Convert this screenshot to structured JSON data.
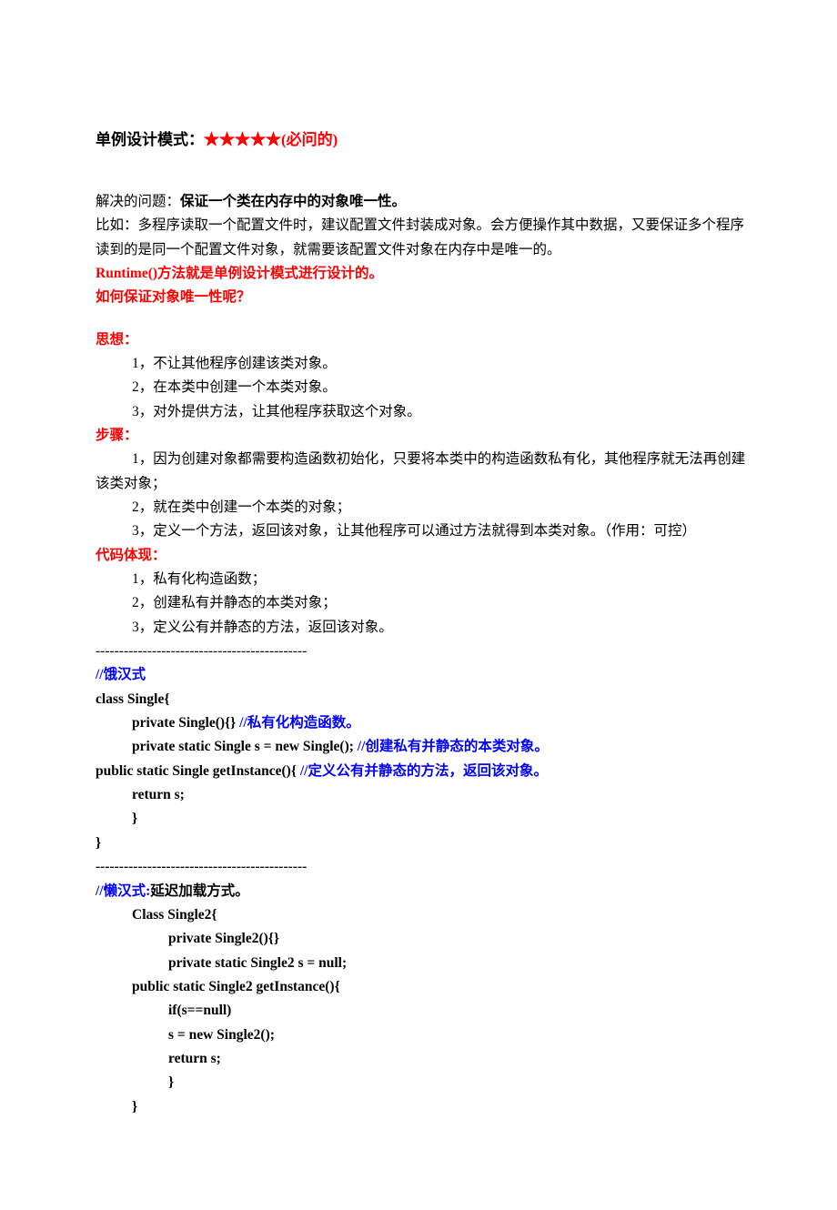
{
  "title_prefix": "单例设计模式：",
  "title_stars": "★★★★★",
  "title_suffix": "(必问的)",
  "intro1a": "解决的问题：",
  "intro1b": "保证一个类在内存中的对象唯一性。",
  "intro2": "比如：多程序读取一个配置文件时，建议配置文件封装成对象。会方便操作其中数据，又要保证多个程序读到的是同一个配置文件对象，就需要该配置文件对象在内存中是唯一的。",
  "intro3": "Runtime()方法就是单例设计模式进行设计的。",
  "intro4": "如何保证对象唯一性呢？",
  "h_think": "思想：",
  "think1": "1，不让其他程序创建该类对象。",
  "think2": "2，在本类中创建一个本类对象。",
  "think3": "3，对外提供方法，让其他程序获取这个对象。",
  "h_steps": "步骤：",
  "step1": "1，因为创建对象都需要构造函数初始化，只要将本类中的构造函数私有化，其他程序就无法再创建该类对象；",
  "step2": "2，就在类中创建一个本类的对象；",
  "step3": "3，定义一个方法，返回该对象，让其他程序可以通过方法就得到本类对象。（作用：可控）",
  "h_code": "代码体现：",
  "code1": "1，私有化构造函数；",
  "code2": "2，创建私有并静态的本类对象；",
  "code3": "3，定义公有并静态的方法，返回该对象。",
  "sep": "---------------------------------------------",
  "eager_label": "//饿汉式",
  "eager_l1": "class Single{",
  "eager_l2a": "private Single(){}          ",
  "eager_l2b": "//私有化构造函数。",
  "eager_l3a": "private static Single s = new Single(); ",
  "eager_l3b": "//创建私有并静态的本类对象。",
  "eager_l4a": "public static Single getInstance(){     ",
  "eager_l4b": "//定义公有并静态的方法，返回该对象。",
  "eager_l5": "return s;",
  "eager_l6": "}",
  "eager_l7": "}",
  "lazy_label": "//懒汉式:",
  "lazy_label2": "延迟加载方式。",
  "lazy_l1": "Class Single2{",
  "lazy_l2": "private Single2(){}",
  "lazy_l3": "private static Single2 s = null;",
  "lazy_l4": "public static Single2 getInstance(){",
  "lazy_l5": "if(s==null)",
  "lazy_l6": "s = new Single2();",
  "lazy_l7": "return s;",
  "lazy_l8": "}",
  "lazy_l9": "}"
}
